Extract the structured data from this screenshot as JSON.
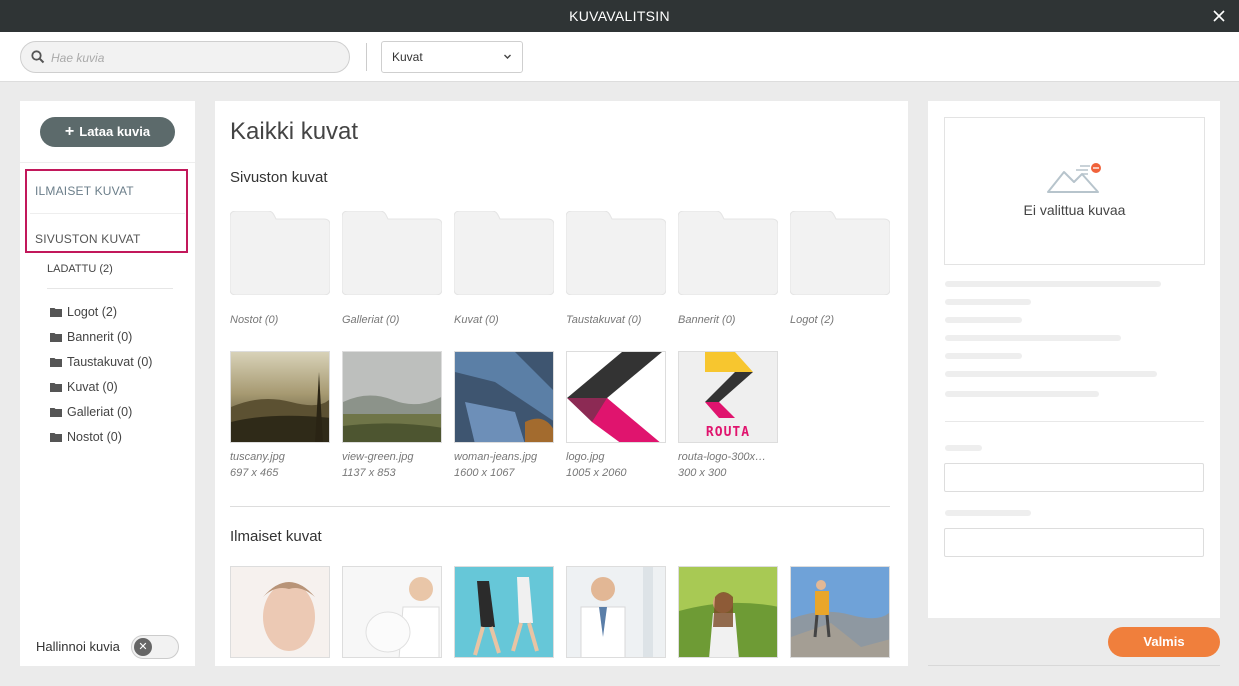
{
  "window": {
    "title": "KUVAVALITSIN",
    "close_icon": "close-icon"
  },
  "toolbar": {
    "search": {
      "placeholder": "Hae kuvia",
      "value": ""
    },
    "filter": {
      "selected": "Kuvat"
    }
  },
  "sidebar": {
    "upload_label": "Lataa kuvia",
    "categories": [
      "ILMAISET KUVAT",
      "SIVUSTON KUVAT"
    ],
    "uploaded": "LADATTU (2)",
    "folders": [
      "Logot (2)",
      "Bannerit (0)",
      "Taustakuvat (0)",
      "Kuvat (0)",
      "Galleriat (0)",
      "Nostot (0)"
    ],
    "manage_label": "Hallinnoi kuvia",
    "manage_enabled": false,
    "highlight_color": "#c2185b"
  },
  "main": {
    "title": "Kaikki kuvat",
    "site_section_title": "Sivuston kuvat",
    "folders": [
      "Nostot (0)",
      "Galleriat (0)",
      "Kuvat (0)",
      "Taustakuvat (0)",
      "Bannerit (0)",
      "Logot (2)"
    ],
    "images": [
      {
        "name": "tuscany.jpg",
        "dims": "697 x 465"
      },
      {
        "name": "view-green.jpg",
        "dims": "1137 x 853"
      },
      {
        "name": "woman-jeans.jpg",
        "dims": "1600 x 1067"
      },
      {
        "name": "logo.jpg",
        "dims": "1005 x 2060"
      },
      {
        "name": "routa-logo-300x…",
        "dims": "300 x 300",
        "logo_text": "ROUTA"
      }
    ],
    "free_section_title": "Ilmaiset kuvat"
  },
  "preview": {
    "no_image": "Ei valittua kuvaa"
  },
  "actions": {
    "done_label": "Valmis",
    "accent": "#f07f3c"
  }
}
